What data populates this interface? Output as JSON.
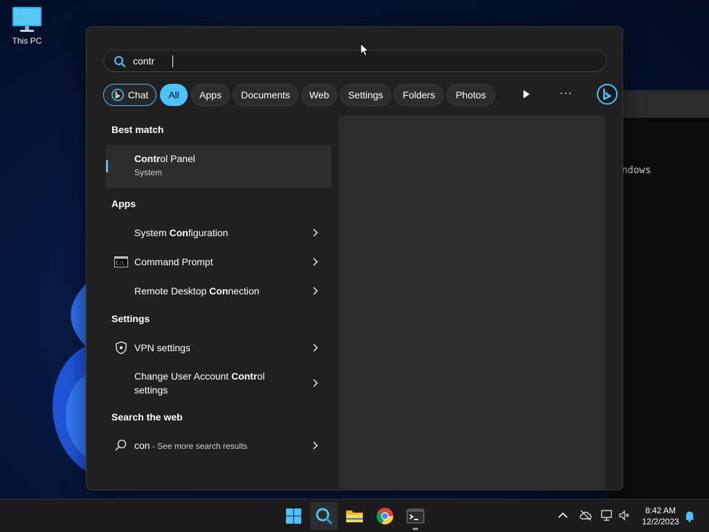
{
  "desktop": {
    "this_pc_label": "This PC"
  },
  "background_window": {
    "text": "ndows"
  },
  "search": {
    "query": "contr"
  },
  "filters": {
    "chat": "Chat",
    "all": "All",
    "apps": "Apps",
    "documents": "Documents",
    "web": "Web",
    "settings": "Settings",
    "folders": "Folders",
    "photos": "Photos",
    "more": "···"
  },
  "best_match": {
    "title": "Best match",
    "item": {
      "match": "Contr",
      "rest": "ol Panel",
      "subtitle": "System"
    }
  },
  "apps": {
    "title": "Apps",
    "items": [
      {
        "pre": "System ",
        "match": "Con",
        "post": "figuration"
      },
      {
        "pre": "Command Prompt",
        "match": "",
        "post": ""
      },
      {
        "pre": "Remote Desktop ",
        "match": "Con",
        "post": "nection"
      }
    ]
  },
  "settings": {
    "title": "Settings",
    "items": [
      {
        "pre": "VPN settings",
        "match": "",
        "post": ""
      },
      {
        "pre": "Change User Account ",
        "match": "Contr",
        "post": "ol",
        "line2": "settings"
      }
    ]
  },
  "web": {
    "title": "Search the web",
    "query": "con",
    "suffix": " - See more search results"
  },
  "taskbar": {
    "time": "8:42 AM",
    "date": "12/2/2023"
  },
  "colors": {
    "accent": "#4cc2ff",
    "panel": "#202020",
    "taskbar": "#1c1c1c"
  }
}
